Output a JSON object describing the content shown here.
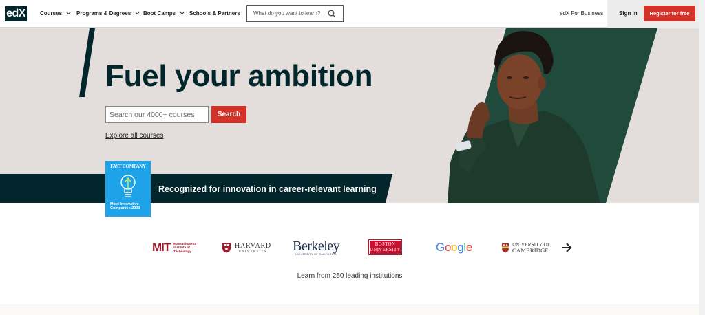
{
  "header": {
    "logo": "edX",
    "nav": [
      {
        "label": "Courses"
      },
      {
        "label": "Programs & Degrees"
      },
      {
        "label": "Boot Camps"
      },
      {
        "label": "Schools & Partners"
      }
    ],
    "search_placeholder": "What do you want to learn?",
    "business_link": "edX For Business",
    "sign_in": "Sign in",
    "register": "Register for free"
  },
  "hero": {
    "headline": "Fuel your ambition",
    "search_placeholder": "Search our 4000+ courses",
    "search_button": "Search",
    "explore_link": "Explore all courses",
    "badge": {
      "brand": "FAST COMPANY",
      "line1": "Most Innovative",
      "line2": "Companies 2023"
    },
    "recognition": "Recognized for innovation in career-relevant learning"
  },
  "partners": {
    "mit": {
      "mark": "MIT",
      "lines": [
        "Massachusetts",
        "Institute of",
        "Technology"
      ]
    },
    "harvard": {
      "name": "HARVARD",
      "sub": "UNIVERSITY"
    },
    "berkeley": {
      "name": "Berkeley",
      "sub": "UNIVERSITY OF CALIFORNIA"
    },
    "boston": {
      "line1": "BOSTON",
      "line2": "UNIVERSITY"
    },
    "google": {
      "name": "Google"
    },
    "cambridge": {
      "line1": "UNIVERSITY OF",
      "line2": "CAMBRIDGE"
    },
    "caption": "Learn from 250 leading institutions"
  },
  "colors": {
    "brand_dark": "#02262b",
    "accent_red": "#d23228",
    "hero_bg": "#e3dedc",
    "badge_blue": "#1ea3e8"
  }
}
